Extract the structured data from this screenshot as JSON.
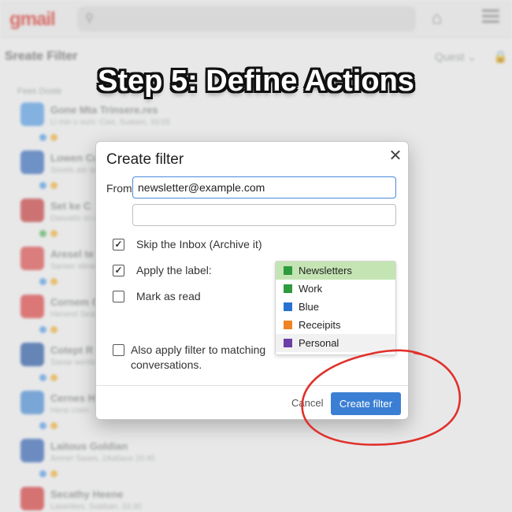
{
  "app": {
    "logo": "gmail",
    "subbar_title": "Sreate Filter",
    "subbar_right": "Quest ⌄",
    "column_header": "Fees  Doste",
    "rows": [
      {
        "sender": "Gone Mta Trinsere.res",
        "snippet": "Li min s oum: Cixe, Suases, 33:03",
        "avatar": "#5aa0e8",
        "dot": "#5aa0e8"
      },
      {
        "sender": "Lowen Co",
        "snippet": "Sovels ate sasent",
        "avatar": "#3a6fc0",
        "dot": "#5aa0e8"
      },
      {
        "sender": "Set ke C",
        "snippet": "Dassatts sn sem",
        "avatar": "#c94040",
        "dot": "#5cb85c"
      },
      {
        "sender": "Aresel te",
        "snippet": "Sanser stinson",
        "avatar": "#e05050",
        "dot": "#5aa0e8"
      },
      {
        "sender": "Cornem C",
        "snippet": "Henerel Sesec",
        "avatar": "#e04848",
        "dot": "#5aa0e8"
      },
      {
        "sender": "Cotept R",
        "snippet": "Sasse wenlion",
        "avatar": "#2b5ca8",
        "dot": "#5aa0e8"
      },
      {
        "sender": "Cernes H",
        "snippet": "Hene coen",
        "avatar": "#4a90d9",
        "dot": "#5aa0e8"
      },
      {
        "sender": "Laitous Goldian",
        "snippet": "Amner Sases, 2Aa5ace 20:45",
        "avatar": "#3668b8",
        "dot": "#5aa0e8"
      },
      {
        "sender": "Secathy Heene",
        "snippet": "Lasenbes, Soalsan, 33:30",
        "avatar": "#d84040",
        "dot": "#5aa0e8"
      }
    ]
  },
  "step_title": "Step 5: Define Actions",
  "dialog": {
    "title": "Create filter",
    "from_label": "From",
    "from_value": "newsletter@example.com",
    "second_value": "",
    "options": {
      "skip_inbox": {
        "label": "Skip the Inbox (Archive it)",
        "checked": true
      },
      "apply_label": {
        "label": "Apply the label:",
        "checked": true
      },
      "mark_read": {
        "label": "Mark as read",
        "checked": false
      },
      "also_apply": {
        "label": "Also apply filter to matching conversations.",
        "checked": false
      }
    },
    "labels": [
      {
        "name": "Newsletters",
        "color": "#2e9b3c",
        "selected": true
      },
      {
        "name": "Work",
        "color": "#2e9b3c",
        "selected": false
      },
      {
        "name": "Blue",
        "color": "#2a72d0",
        "selected": false
      },
      {
        "name": "Receipits",
        "color": "#f08324",
        "selected": false
      },
      {
        "name": "Personal",
        "color": "#6b3fa8",
        "selected": false
      }
    ],
    "cancel_label": "Cancel",
    "create_label": "Create filter"
  },
  "colors": {
    "accent": "#3b7fd4",
    "annotation": "#e0302a"
  }
}
